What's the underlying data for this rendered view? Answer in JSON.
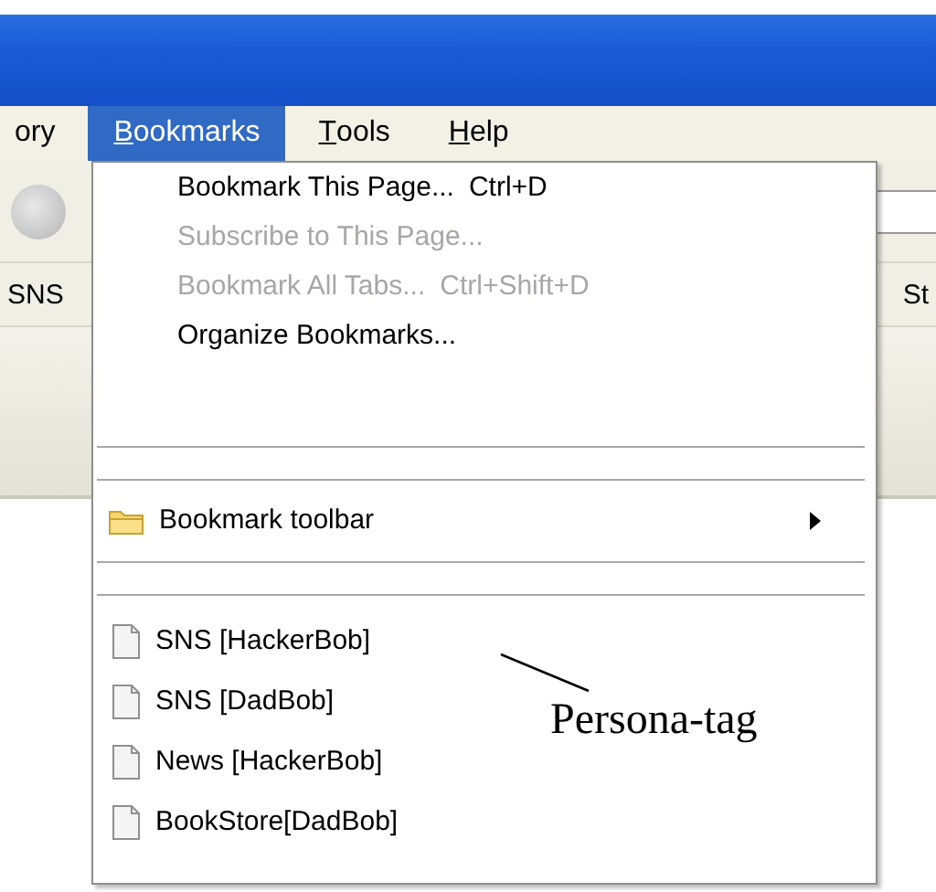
{
  "menubar": {
    "items": [
      {
        "label": "ory",
        "selected": false,
        "underline_first": false
      },
      {
        "label": "Bookmarks",
        "selected": true,
        "underline_first": true
      },
      {
        "label": "Tools",
        "selected": false,
        "underline_first": true
      },
      {
        "label": "Help",
        "selected": false,
        "underline_first": true
      }
    ]
  },
  "bookmarks_toolbar": {
    "items": [
      "SNS",
      "St"
    ]
  },
  "menu": {
    "items": [
      {
        "kind": "command",
        "label": "Bookmark This Page...",
        "shortcut": "Ctrl+D",
        "disabled": false
      },
      {
        "kind": "command",
        "label": "Subscribe to This Page...",
        "disabled": true
      },
      {
        "kind": "command",
        "label": "Bookmark All Tabs...",
        "shortcut": "Ctrl+Shift+D",
        "disabled": true
      },
      {
        "kind": "command",
        "label": "Organize Bookmarks...",
        "disabled": false
      },
      {
        "kind": "separator"
      },
      {
        "kind": "separator"
      },
      {
        "kind": "folder",
        "label": "Bookmark toolbar"
      },
      {
        "kind": "separator"
      },
      {
        "kind": "separator"
      },
      {
        "kind": "bookmark",
        "label": "SNS [HackerBob]"
      },
      {
        "kind": "bookmark",
        "label": "SNS [DadBob]"
      },
      {
        "kind": "bookmark",
        "label": "News [HackerBob]"
      },
      {
        "kind": "bookmark",
        "label": "BookStore[DadBob]"
      }
    ]
  },
  "annotation": {
    "text": "Persona-tag"
  }
}
